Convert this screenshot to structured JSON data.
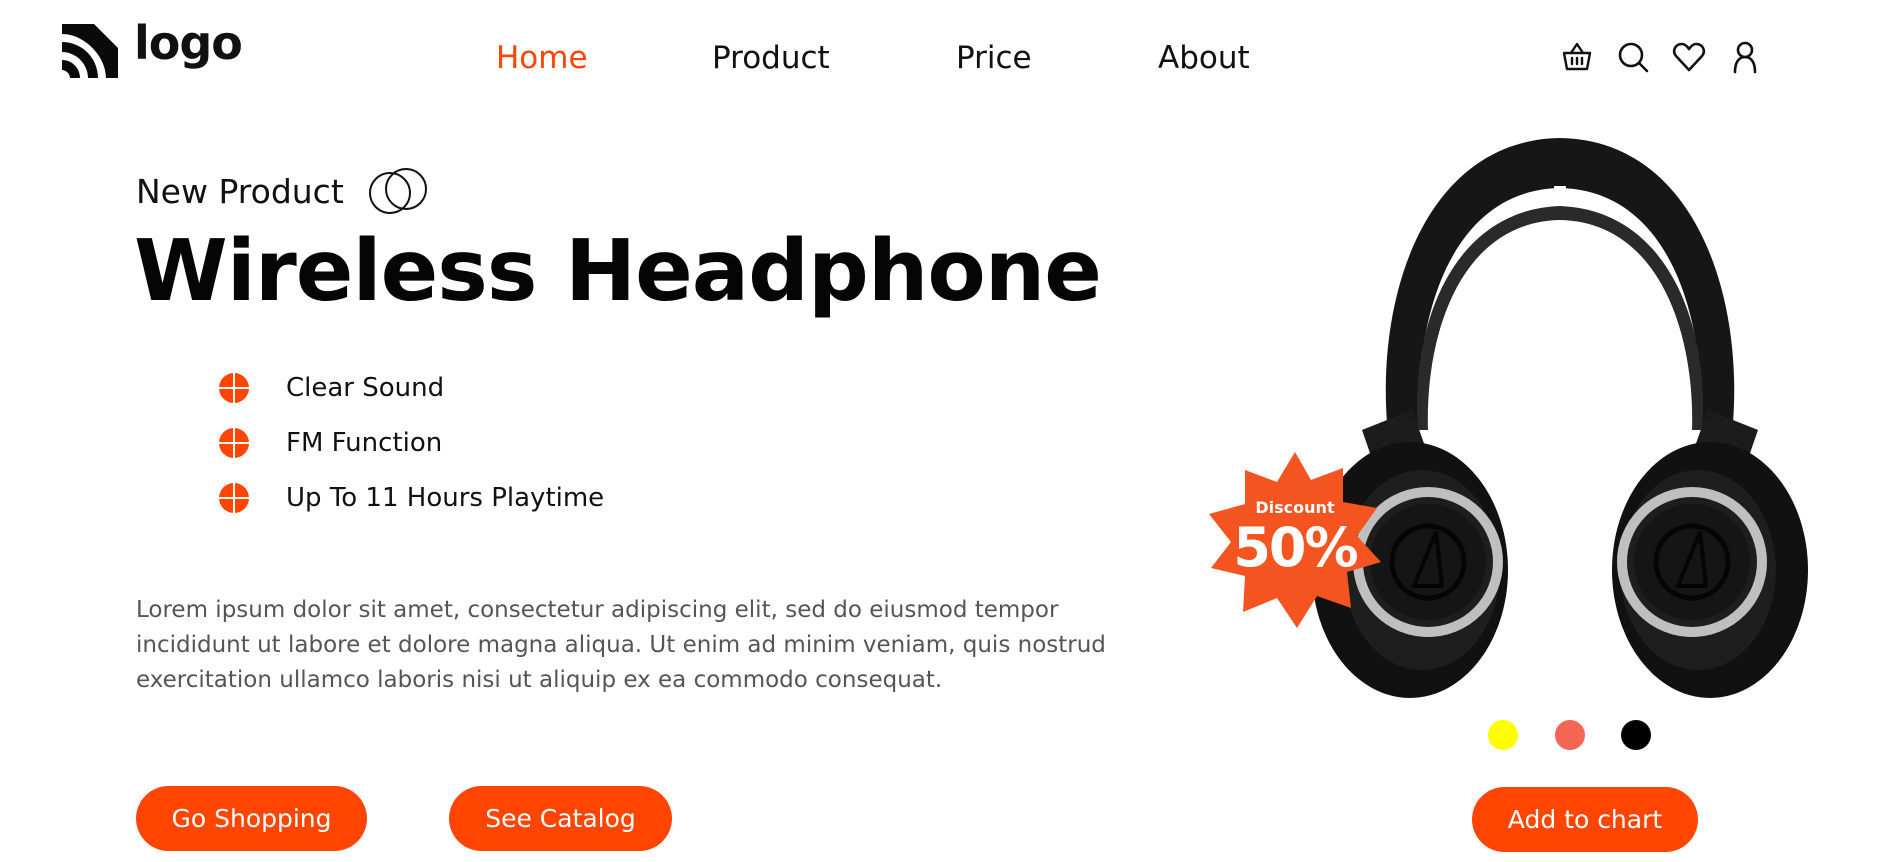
{
  "header": {
    "logo_text": "logo",
    "nav": [
      {
        "label": "Home",
        "active": true
      },
      {
        "label": "Product",
        "active": false
      },
      {
        "label": "Price",
        "active": false
      },
      {
        "label": "About",
        "active": false
      }
    ],
    "icons": [
      "basket-icon",
      "search-icon",
      "heart-icon",
      "user-icon"
    ]
  },
  "hero": {
    "eyebrow": "New Product",
    "title": "Wireless Headphone",
    "features": [
      {
        "label": "Clear Sound"
      },
      {
        "label": "FM Function"
      },
      {
        "label": "Up To 11 Hours Playtime"
      }
    ],
    "description": "Lorem ipsum dolor sit amet, consectetur adipiscing elit, sed do eiusmod tempor incididunt ut labore et dolore magna aliqua. Ut enim ad minim veniam, quis nostrud exercitation ullamco laboris nisi ut aliquip ex ea commodo consequat.",
    "buttons": {
      "shop": "Go Shopping",
      "catalog": "See Catalog"
    }
  },
  "product": {
    "badge_label": "Discount",
    "badge_value": "50%",
    "swatches": [
      {
        "color": "#ffff00"
      },
      {
        "color": "#f46552"
      },
      {
        "color": "#000000"
      }
    ],
    "add_button": "Add to chart"
  },
  "colors": {
    "accent": "#ff4500",
    "text": "#111111",
    "muted": "#555555"
  }
}
